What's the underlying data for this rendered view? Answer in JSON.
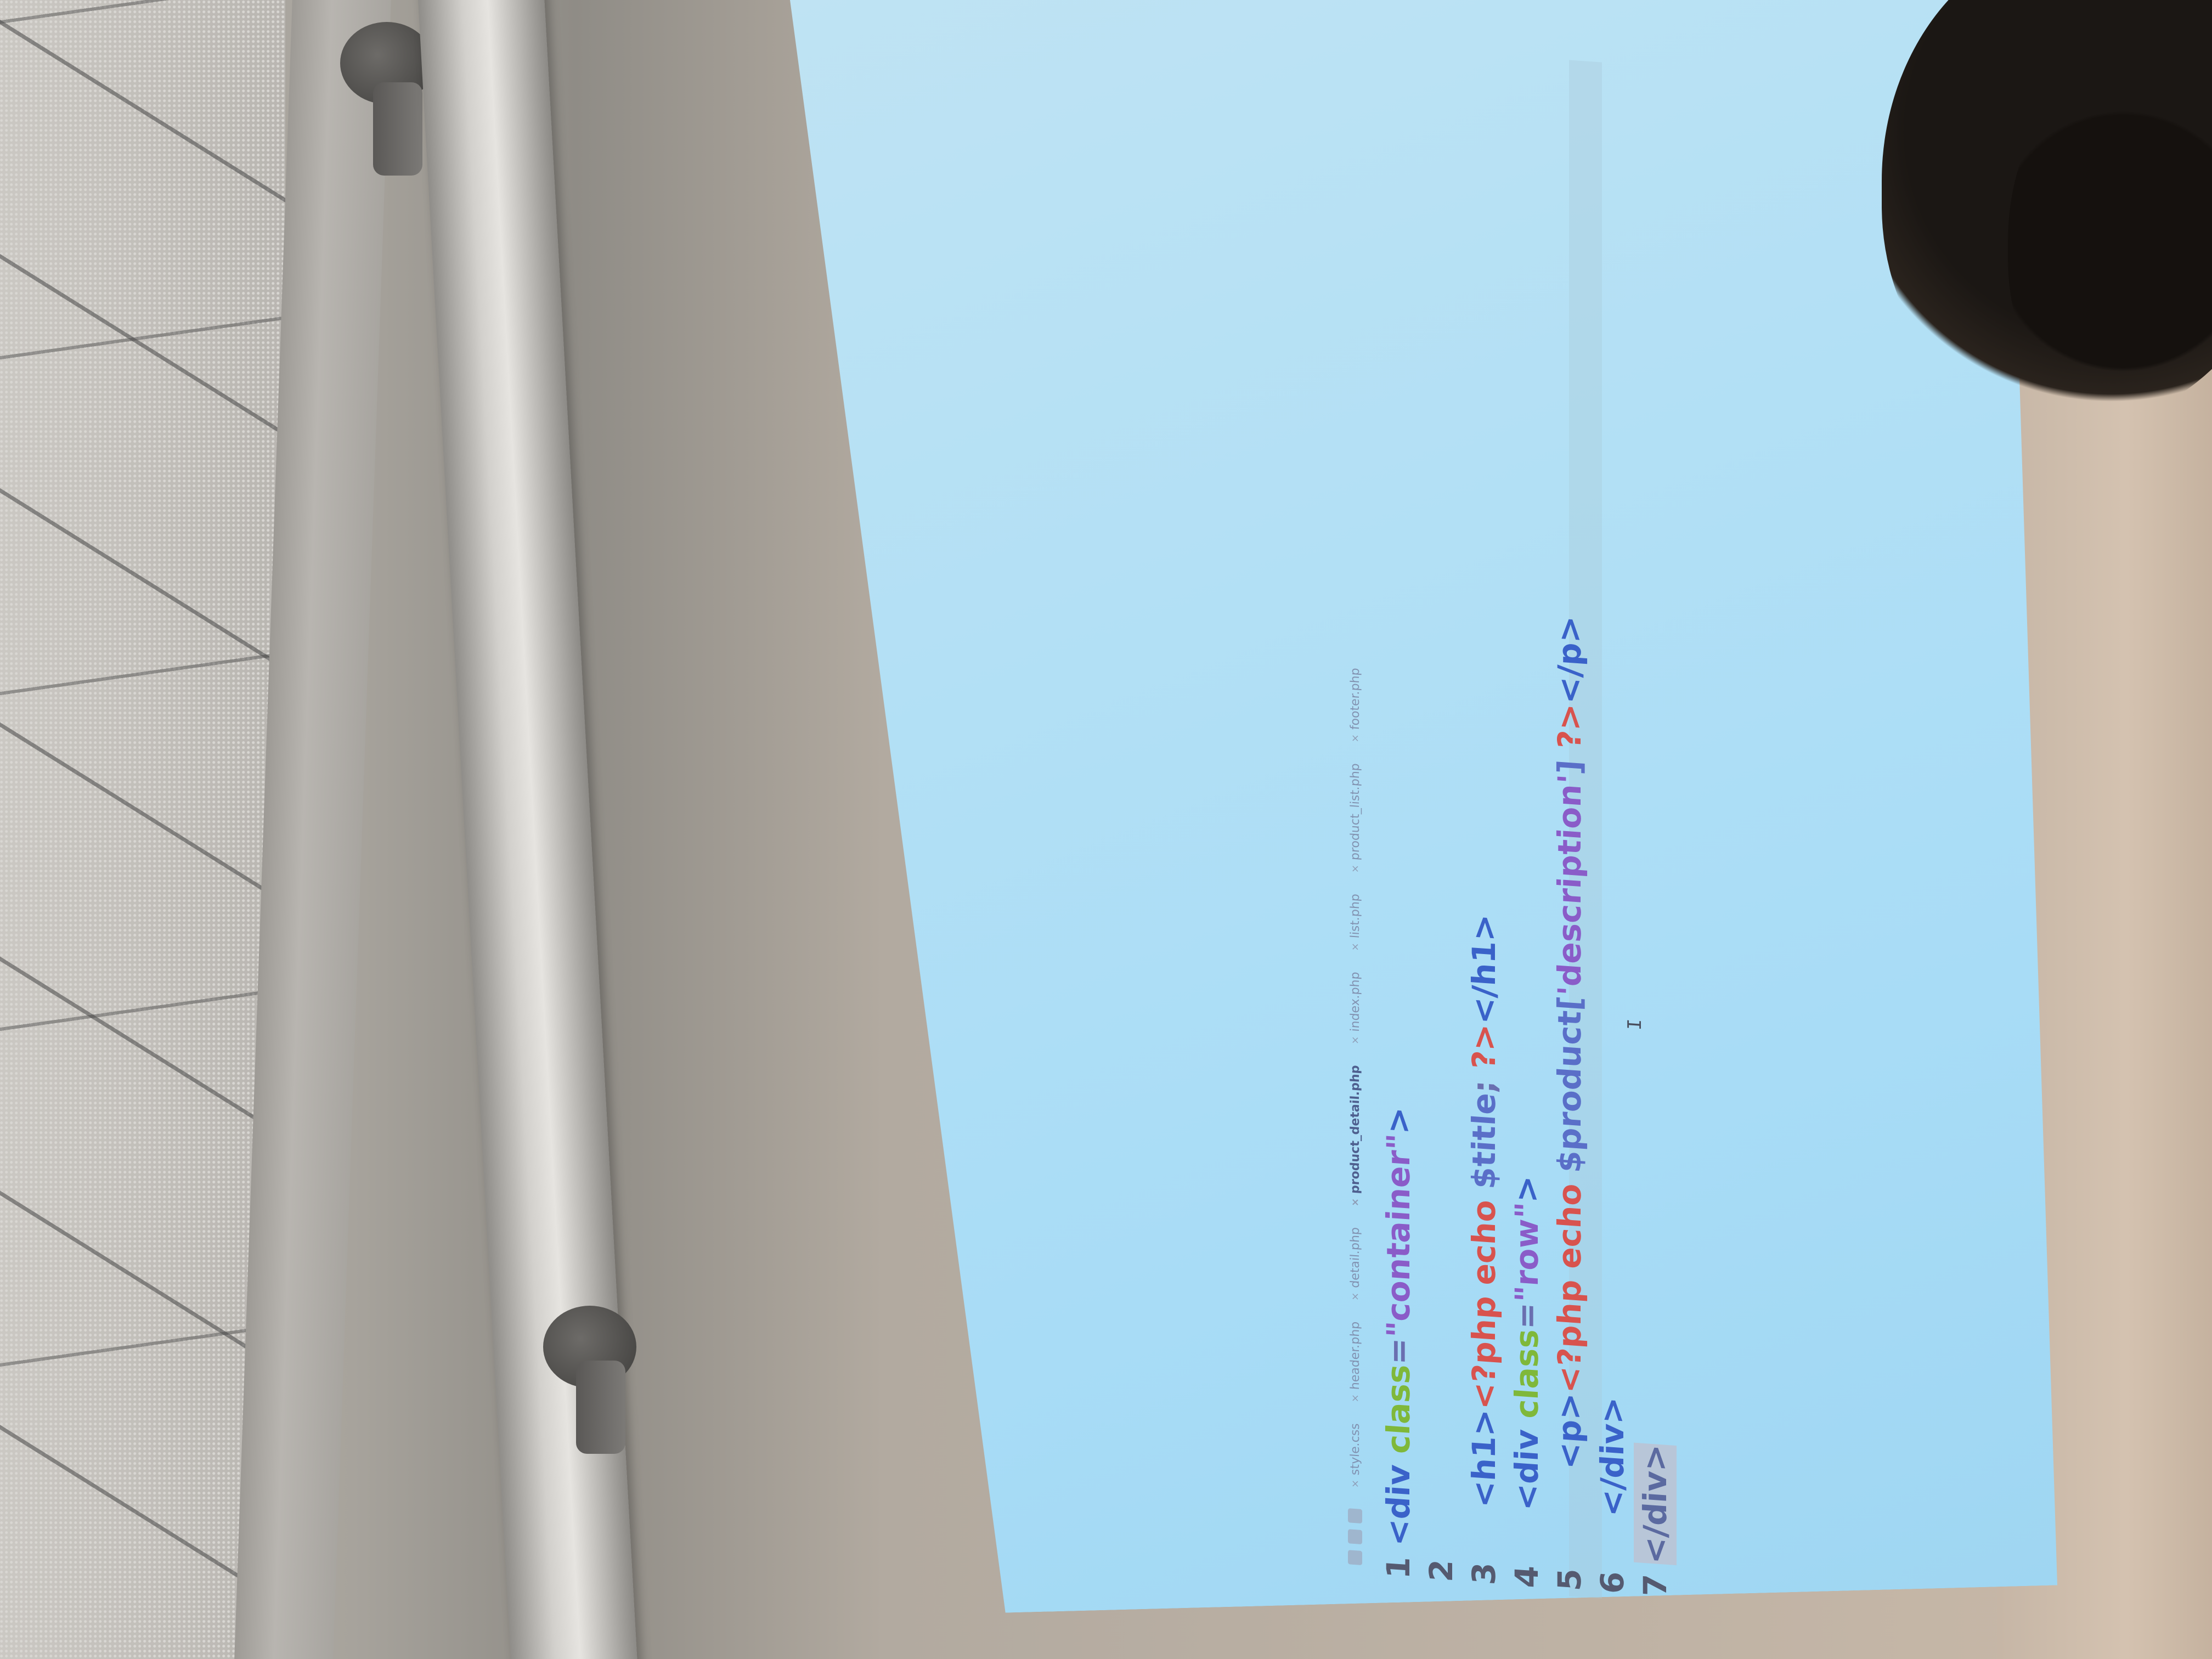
{
  "editor": {
    "tabs": [
      {
        "label": "style.css",
        "active": false
      },
      {
        "label": "header.php",
        "active": false
      },
      {
        "label": "detail.php",
        "active": false
      },
      {
        "label": "product_detail.php",
        "active": true
      },
      {
        "label": "index.php",
        "active": false
      },
      {
        "label": "list.php",
        "active": false
      },
      {
        "label": "product_list.php",
        "active": false
      },
      {
        "label": "footer.php",
        "active": false
      }
    ],
    "code_lines": [
      {
        "num": "1",
        "tokens": [
          {
            "t": "<div ",
            "c": "tag"
          },
          {
            "t": "class",
            "c": "attr"
          },
          {
            "t": "=",
            "c": "plain"
          },
          {
            "t": "\"container\"",
            "c": "str"
          },
          {
            "t": ">",
            "c": "tag"
          }
        ]
      },
      {
        "num": "2",
        "tokens": []
      },
      {
        "num": "3",
        "tokens": [
          {
            "t": "    <h1>",
            "c": "tag"
          },
          {
            "t": "<?php ",
            "c": "php"
          },
          {
            "t": "echo ",
            "c": "kw"
          },
          {
            "t": "$title",
            "c": "var"
          },
          {
            "t": "; ",
            "c": "plain"
          },
          {
            "t": "?>",
            "c": "php"
          },
          {
            "t": "</h1>",
            "c": "tag"
          }
        ]
      },
      {
        "num": "3",
        "tokens": [
          {
            "t": "    <div ",
            "c": "tag"
          },
          {
            "t": "class",
            "c": "attr"
          },
          {
            "t": "=",
            "c": "plain"
          },
          {
            "t": "\"row\"",
            "c": "str"
          },
          {
            "t": ">",
            "c": "tag"
          }
        ]
      },
      {
        "num": "4",
        "tokens": [
          {
            "t": "        <p>",
            "c": "tag"
          },
          {
            "t": "<?php ",
            "c": "php"
          },
          {
            "t": "echo ",
            "c": "kw"
          },
          {
            "t": "$product[",
            "c": "var"
          },
          {
            "t": "'description'",
            "c": "str"
          },
          {
            "t": "] ",
            "c": "var"
          },
          {
            "t": "?>",
            "c": "php"
          },
          {
            "t": "</p>",
            "c": "tag"
          }
        ]
      },
      {
        "num": "5",
        "tokens": [
          {
            "t": "    </div>",
            "c": "tag"
          }
        ]
      },
      {
        "num": "6",
        "tokens": [
          {
            "t": "</div>",
            "c": "tag",
            "cursor": true
          }
        ]
      }
    ],
    "line_numbers_visible": [
      "1",
      "2",
      "3",
      "4",
      "5",
      "6",
      "7"
    ]
  },
  "icons": {
    "close": "×",
    "ibeam": "I"
  },
  "colors": {
    "screen": "#b3e0f5",
    "tag": "#3a62c9",
    "attr": "#7fb83a",
    "string": "#8a5cc8",
    "php": "#d8534e"
  }
}
